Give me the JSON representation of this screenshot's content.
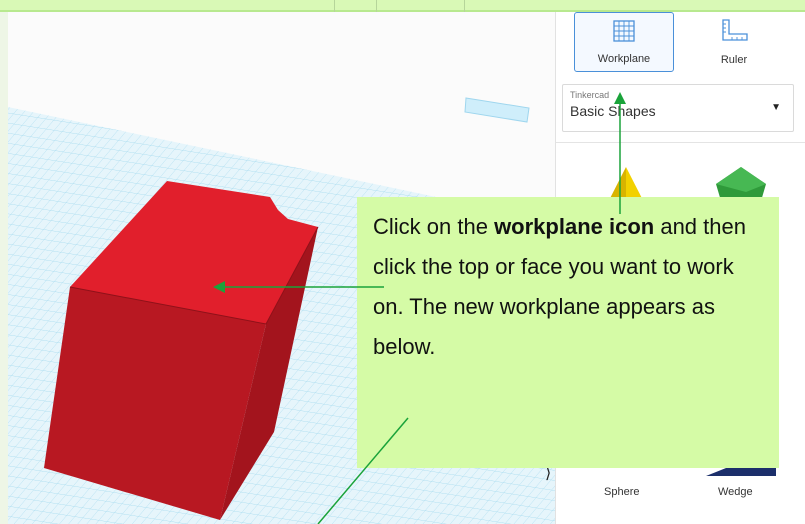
{
  "toolbar": {
    "workplane_label": "Workplane",
    "ruler_label": "Ruler"
  },
  "library": {
    "source": "Tinkercad",
    "category": "Basic Shapes"
  },
  "shapes": {
    "sphere_label": "Sphere",
    "wedge_label": "Wedge"
  },
  "callout": {
    "text_before": "Click on the ",
    "text_bold": "workplane icon",
    "text_after": " and then click the top or face you want to work on. The new workplane appears as below."
  },
  "colors": {
    "callout_bg": "#d5fba6",
    "box_front": "#b81822",
    "box_top": "#e11f2c",
    "box_side": "#a3141d",
    "grid": "#a9dcef",
    "accent": "#4a90d9",
    "arrow": "#1aa33a"
  },
  "icons": [
    "workplane-icon",
    "ruler-icon",
    "chevron-down-icon",
    "chevron-right-icon",
    "pyramid-icon",
    "gem-icon"
  ]
}
